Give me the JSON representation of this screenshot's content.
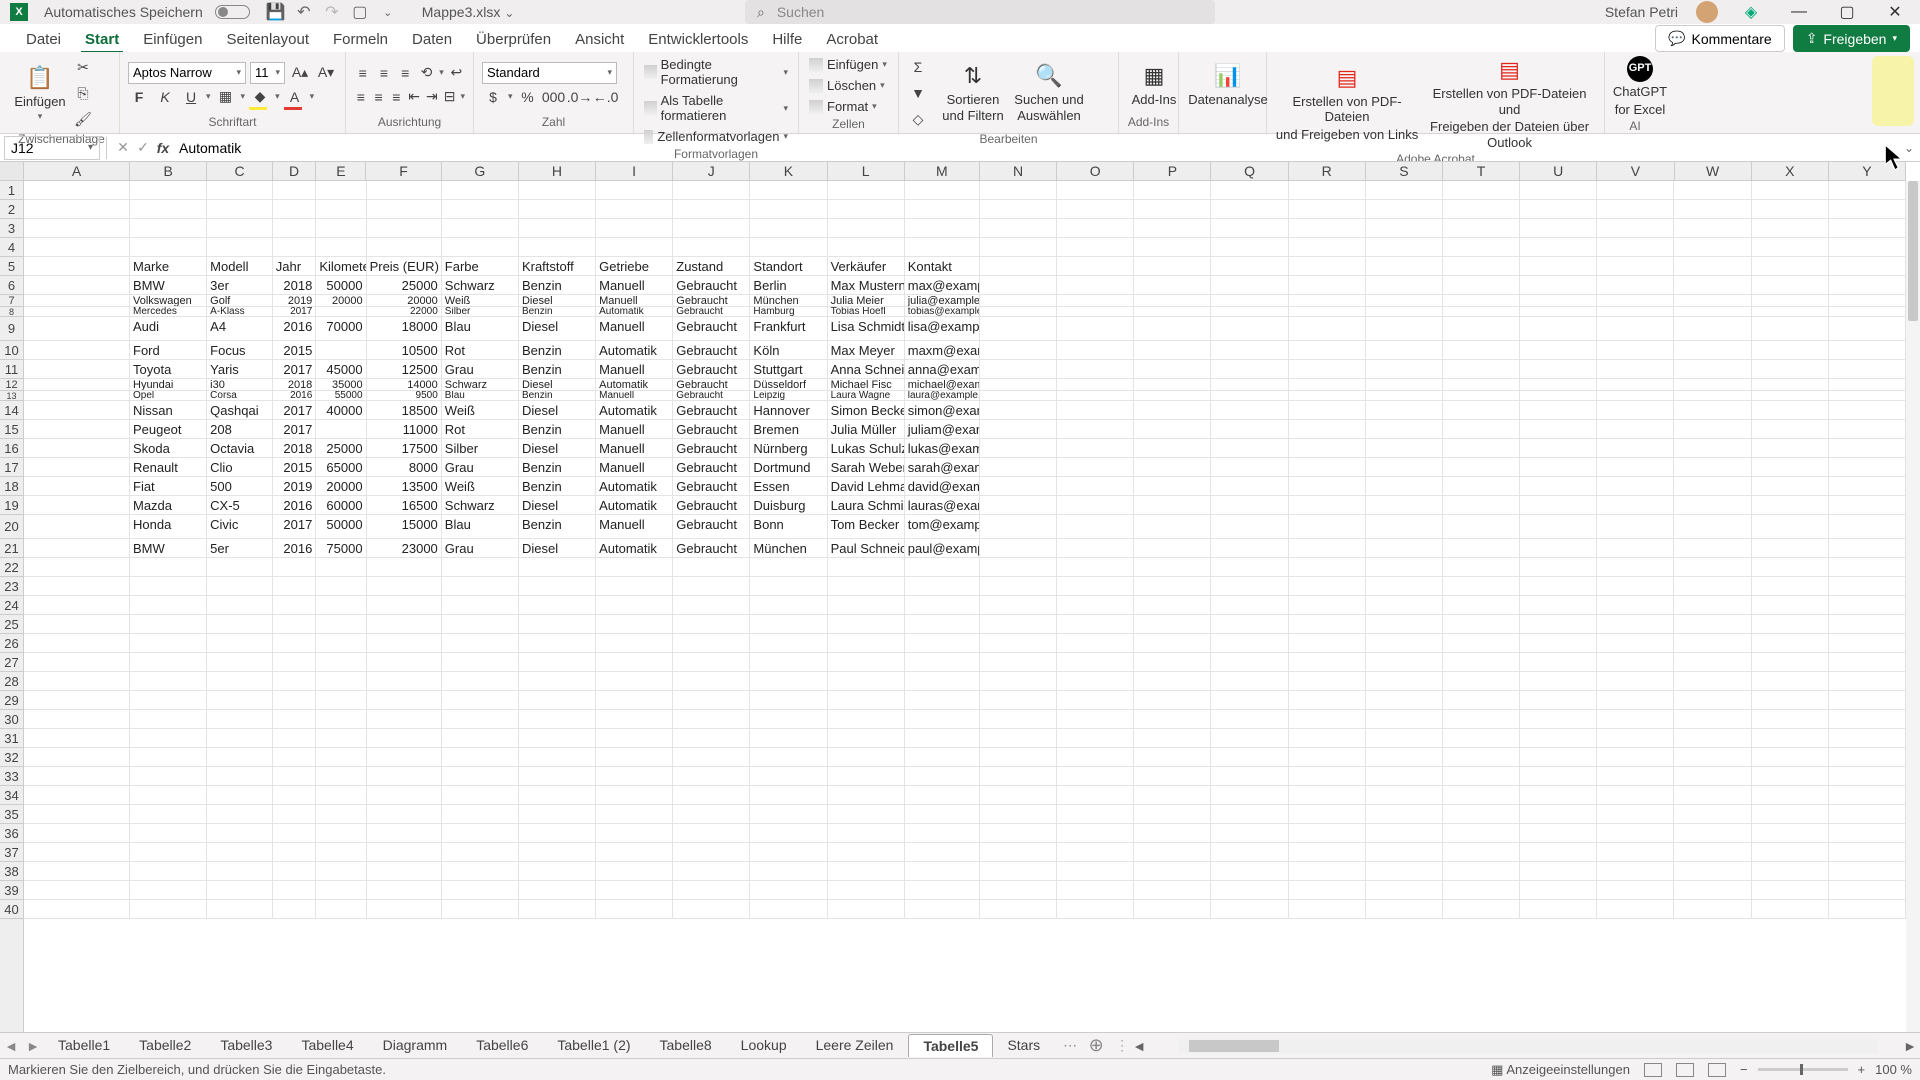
{
  "titlebar": {
    "autosave": "Automatisches Speichern",
    "filename": "Mappe3.xlsx",
    "search_placeholder": "Suchen",
    "user": "Stefan Petri"
  },
  "tabs": [
    "Datei",
    "Start",
    "Einfügen",
    "Seitenlayout",
    "Formeln",
    "Daten",
    "Überprüfen",
    "Ansicht",
    "Entwicklertools",
    "Hilfe",
    "Acrobat"
  ],
  "active_tab": 1,
  "comments_label": "Kommentare",
  "share_label": "Freigeben",
  "ribbon": {
    "clipboard": {
      "label": "Zwischenablage",
      "paste": "Einfügen"
    },
    "font": {
      "label": "Schriftart",
      "name": "Aptos Narrow",
      "size": "11",
      "b": "F",
      "i": "K",
      "u": "U"
    },
    "align": {
      "label": "Ausrichtung"
    },
    "number": {
      "label": "Zahl",
      "format": "Standard"
    },
    "styles": {
      "label": "Formatvorlagen",
      "cond": "Bedingte Formatierung",
      "table": "Als Tabelle formatieren",
      "cell": "Zellenformatvorlagen"
    },
    "cells": {
      "label": "Zellen",
      "ins": "Einfügen",
      "del": "Löschen",
      "fmt": "Format"
    },
    "edit": {
      "label": "Bearbeiten",
      "sort": "Sortieren und Filtern",
      "find": "Suchen und Auswählen"
    },
    "addins": {
      "label": "Add-Ins",
      "btn": "Add-Ins"
    },
    "analysis": {
      "label": "",
      "btn": "Datenanalyse"
    },
    "acrobat": {
      "label": "Adobe Acrobat",
      "pdf1a": "Erstellen von PDF-Dateien",
      "pdf1b": "und Freigeben von Links",
      "pdf2a": "Erstellen von PDF-Dateien und",
      "pdf2b": "Freigeben der Dateien über Outlook"
    },
    "ai": {
      "label": "AI",
      "btn1": "ChatGPT",
      "btn2": "for Excel"
    }
  },
  "namebox": "J12",
  "formula": "Automatik",
  "columns": [
    "A",
    "B",
    "C",
    "D",
    "E",
    "F",
    "G",
    "H",
    "I",
    "J",
    "K",
    "L",
    "M",
    "N",
    "O",
    "P",
    "Q",
    "R",
    "S",
    "T",
    "U",
    "V",
    "W",
    "X",
    "Y"
  ],
  "widths": [
    110,
    80,
    68,
    45,
    52,
    78,
    80,
    80,
    80,
    80,
    80,
    80,
    78,
    80,
    80,
    80,
    80,
    80,
    80,
    80,
    80,
    80,
    80,
    80,
    80
  ],
  "rowcount": 40,
  "headers": [
    "Marke",
    "Modell",
    "Jahr",
    "Kilometer",
    "Preis (EUR)",
    "Farbe",
    "Kraftstoff",
    "Getriebe",
    "Zustand",
    "Standort",
    "Verkäufer",
    "Kontakt"
  ],
  "header_row": 5,
  "data_start_col": 1,
  "special_rows": {
    "6": "norm",
    "7": "sh",
    "8": "tn",
    "9": "sp",
    "12": "sh",
    "13": "tn",
    "20": "sp"
  },
  "data": {
    "6": [
      "BMW",
      "3er",
      "2018",
      "50000",
      "25000",
      "Schwarz",
      "Benzin",
      "Manuell",
      "Gebraucht",
      "Berlin",
      "Max Mustern",
      "max@example.com"
    ],
    "7": [
      "Volkswagen",
      "Golf",
      "2019",
      "20000",
      "20000",
      "Weiß",
      "Diesel",
      "Manuell",
      "Gebraucht",
      "München",
      "Julia Meier",
      "julia@example.com"
    ],
    "8": [
      "Mercedes",
      "A-Klass",
      "2017",
      "",
      "22000",
      "Silber",
      "Benzin",
      "Automatik",
      "Gebraucht",
      "Hamburg",
      "Tobias Hoefl",
      "tobias@example.com"
    ],
    "9": [
      "Audi",
      "A4",
      "2016",
      "70000",
      "18000",
      "Blau",
      "Diesel",
      "Manuell",
      "Gebraucht",
      "Frankfurt",
      "Lisa Schmidt",
      "lisa@example.com"
    ],
    "10": [
      "Ford",
      "Focus",
      "2015",
      "",
      "10500",
      "Rot",
      "Benzin",
      "Automatik",
      "Gebraucht",
      "Köln",
      "Max Meyer",
      "maxm@example.com"
    ],
    "11": [
      "Toyota",
      "Yaris",
      "2017",
      "45000",
      "12500",
      "Grau",
      "Benzin",
      "Manuell",
      "Gebraucht",
      "Stuttgart",
      "Anna Schnei",
      "anna@example.com"
    ],
    "12": [
      "Hyundai",
      "i30",
      "2018",
      "35000",
      "14000",
      "Schwarz",
      "Diesel",
      "Automatik",
      "Gebraucht",
      "Düsseldorf",
      "Michael Fisc",
      "michael@example.com"
    ],
    "13": [
      "Opel",
      "Corsa",
      "2016",
      "55000",
      "9500",
      "Blau",
      "Benzin",
      "Manuell",
      "Gebraucht",
      "Leipzig",
      "Laura Wagne",
      "laura@example.com"
    ],
    "14": [
      "Nissan",
      "Qashqai",
      "2017",
      "40000",
      "18500",
      "Weiß",
      "Diesel",
      "Automatik",
      "Gebraucht",
      "Hannover",
      "Simon Becke",
      "simon@example.com"
    ],
    "15": [
      "Peugeot",
      "208",
      "2017",
      "",
      "11000",
      "Rot",
      "Benzin",
      "Manuell",
      "Gebraucht",
      "Bremen",
      "Julia Müller",
      "juliam@example.com"
    ],
    "16": [
      "Skoda",
      "Octavia",
      "2018",
      "25000",
      "17500",
      "Silber",
      "Diesel",
      "Manuell",
      "Gebraucht",
      "Nürnberg",
      "Lukas Schulz",
      "lukas@example.com"
    ],
    "17": [
      "Renault",
      "Clio",
      "2015",
      "65000",
      "8000",
      "Grau",
      "Benzin",
      "Manuell",
      "Gebraucht",
      "Dortmund",
      "Sarah Weber",
      "sarah@example.com"
    ],
    "18": [
      "Fiat",
      "500",
      "2019",
      "20000",
      "13500",
      "Weiß",
      "Benzin",
      "Automatik",
      "Gebraucht",
      "Essen",
      "David Lehma",
      "david@example.com"
    ],
    "19": [
      "Mazda",
      "CX-5",
      "2016",
      "60000",
      "16500",
      "Schwarz",
      "Diesel",
      "Automatik",
      "Gebraucht",
      "Duisburg",
      "Laura Schmi",
      "lauras@example.com"
    ],
    "20": [
      "Honda",
      "Civic",
      "2017",
      "50000",
      "15000",
      "Blau",
      "Benzin",
      "Manuell",
      "Gebraucht",
      "Bonn",
      "Tom Becker",
      "tom@example.com"
    ],
    "21": [
      "BMW",
      "5er",
      "2016",
      "75000",
      "23000",
      "Grau",
      "Diesel",
      "Automatik",
      "Gebraucht",
      "München",
      "Paul Schneic",
      "paul@example.com"
    ]
  },
  "numeric_cols": [
    2,
    3,
    4
  ],
  "sheets": [
    "Tabelle1",
    "Tabelle2",
    "Tabelle3",
    "Tabelle4",
    "Diagramm",
    "Tabelle6",
    "Tabelle1 (2)",
    "Tabelle8",
    "Lookup",
    "Leere Zeilen",
    "Tabelle5",
    "Stars"
  ],
  "active_sheet": 10,
  "status": {
    "msg": "Markieren Sie den Zielbereich, und drücken Sie die Eingabetaste.",
    "display": "Anzeigeeinstellungen",
    "zoom": "100 %"
  }
}
